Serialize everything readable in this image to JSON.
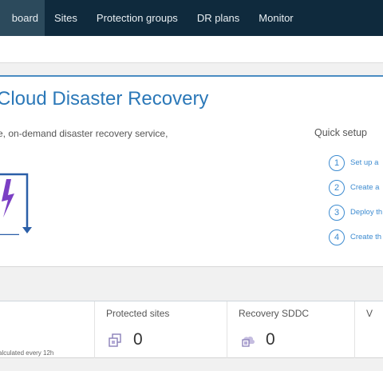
{
  "nav": {
    "tabs": [
      {
        "label": "board",
        "active": true
      },
      {
        "label": "Sites"
      },
      {
        "label": "Protection groups"
      },
      {
        "label": "DR plans"
      },
      {
        "label": "Monitor"
      }
    ]
  },
  "hero": {
    "title": "Cloud Disaster Recovery",
    "description": "e, on-demand disaster recovery service,"
  },
  "quick_setup": {
    "title": "Quick setup",
    "steps": [
      {
        "num": "1",
        "label": "Set up a"
      },
      {
        "num": "2",
        "label": "Create a"
      },
      {
        "num": "3",
        "label": "Deploy th"
      },
      {
        "num": "4",
        "label": "Create th"
      }
    ]
  },
  "cards": {
    "first": {
      "footnote": "alculated every 12h"
    },
    "protected_sites": {
      "label": "Protected sites",
      "value": "0",
      "icon": "protected-sites-icon"
    },
    "recovery_sddc": {
      "label": "Recovery SDDC",
      "value": "0",
      "icon": "recovery-sddc-icon"
    },
    "fourth": {
      "label": "V"
    }
  },
  "colors": {
    "nav_bg": "#0f2a3d",
    "accent": "#2b78b8",
    "illustration": "#2b5fa8",
    "lightning": "#7b3fc4"
  }
}
